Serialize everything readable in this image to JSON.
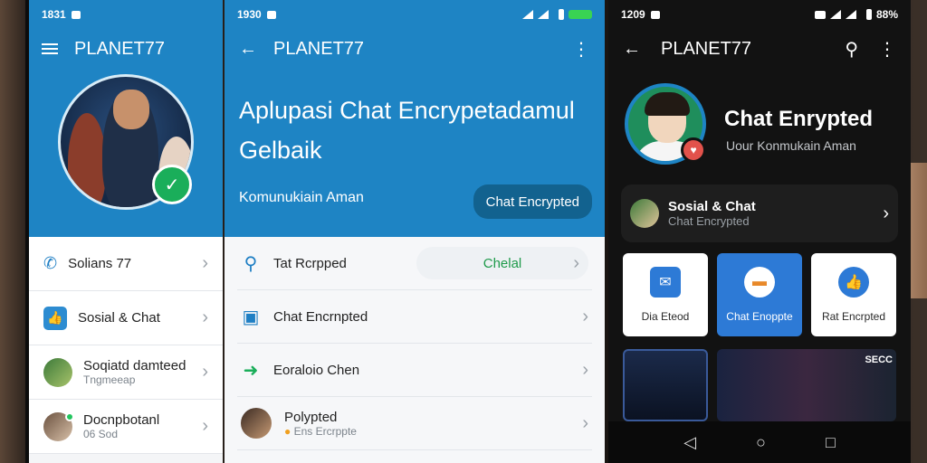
{
  "phone1": {
    "status": {
      "time": "1831"
    },
    "title": "PLANET77",
    "rows": [
      {
        "label": "Solians 77",
        "icon": "phone-icon"
      },
      {
        "label": "Sosial & Chat",
        "icon": "thumbs-up-icon"
      },
      {
        "label": "Soqiatd damteed",
        "sub": "Tngmeeap"
      },
      {
        "label": "Docnpbotanl",
        "sub": "06 Sod"
      }
    ]
  },
  "phone2": {
    "status": {
      "time": "1930"
    },
    "title": "PLANET77",
    "hero_title": "Aplupasi Chat Encrypetadamul Gelbaik",
    "hero_sub": "Komunukiain Aman",
    "hero_button": "Chat Encrypted",
    "rows": [
      {
        "label": "Tat Rcrpped",
        "pill": "Chelal",
        "icon": "search-icon"
      },
      {
        "label": "Chat Encrnpted",
        "icon": "lock-icon"
      },
      {
        "label": "Eoraloio Chen",
        "icon": "arrow-icon"
      },
      {
        "label": "Polypted",
        "sub": "Ens Ercrppte",
        "icon": "avatar"
      }
    ]
  },
  "phone3": {
    "status": {
      "time": "1209",
      "battery": "88%"
    },
    "title": "PLANET77",
    "profile_name": "Chat Enrypted",
    "profile_sub": "Uour Konmukain Aman",
    "card": {
      "title": "Sosial & Chat",
      "sub": "Chat Encrypted"
    },
    "tiles": [
      {
        "label": "Dia Eteod",
        "color": "#2d7ad6"
      },
      {
        "label": "Chat Enoppte",
        "color": "#f0f0f0"
      },
      {
        "label": "Rat Encrpted",
        "color": "#2d7ad6"
      }
    ],
    "thumb_label": "SECC"
  },
  "colors": {
    "brand_blue": "#1e84c4",
    "accent_green": "#1aae5a"
  }
}
